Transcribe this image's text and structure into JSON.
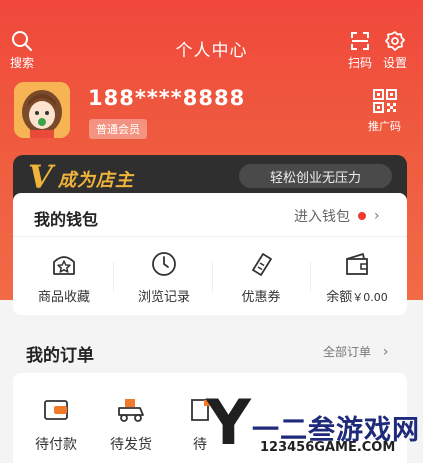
{
  "header": {
    "title": "个人中心",
    "search_label": "搜索",
    "scan_label": "扫码",
    "settings_label": "设置",
    "background_color": "#f0483c"
  },
  "profile": {
    "phone": "188****8888",
    "member_level": "普通会员",
    "promo_code_label": "推广码"
  },
  "vip_banner": {
    "logo_letter": "V",
    "title": "成为店主",
    "slogan": "轻松创业无压力",
    "accent_color": "#f0b43a"
  },
  "wallet": {
    "title": "我的钱包",
    "link_label": "进入钱包",
    "items": [
      {
        "label": "商品收藏",
        "icon": "star-bag-icon"
      },
      {
        "label": "浏览记录",
        "icon": "clock-icon"
      },
      {
        "label": "优惠券",
        "icon": "ticket-icon"
      },
      {
        "label": "余额",
        "value": "￥0.00",
        "icon": "wallet-icon"
      }
    ]
  },
  "orders": {
    "title": "我的订单",
    "all_label": "全部订单",
    "items": [
      {
        "label": "待付款",
        "icon": "card-icon"
      },
      {
        "label": "待发货",
        "icon": "delivery-icon"
      },
      {
        "label": "待",
        "icon": "box-icon"
      }
    ]
  },
  "watermark": {
    "letter": "Y",
    "brand": "一二叁游戏网",
    "url": "123456GAME.COM"
  }
}
